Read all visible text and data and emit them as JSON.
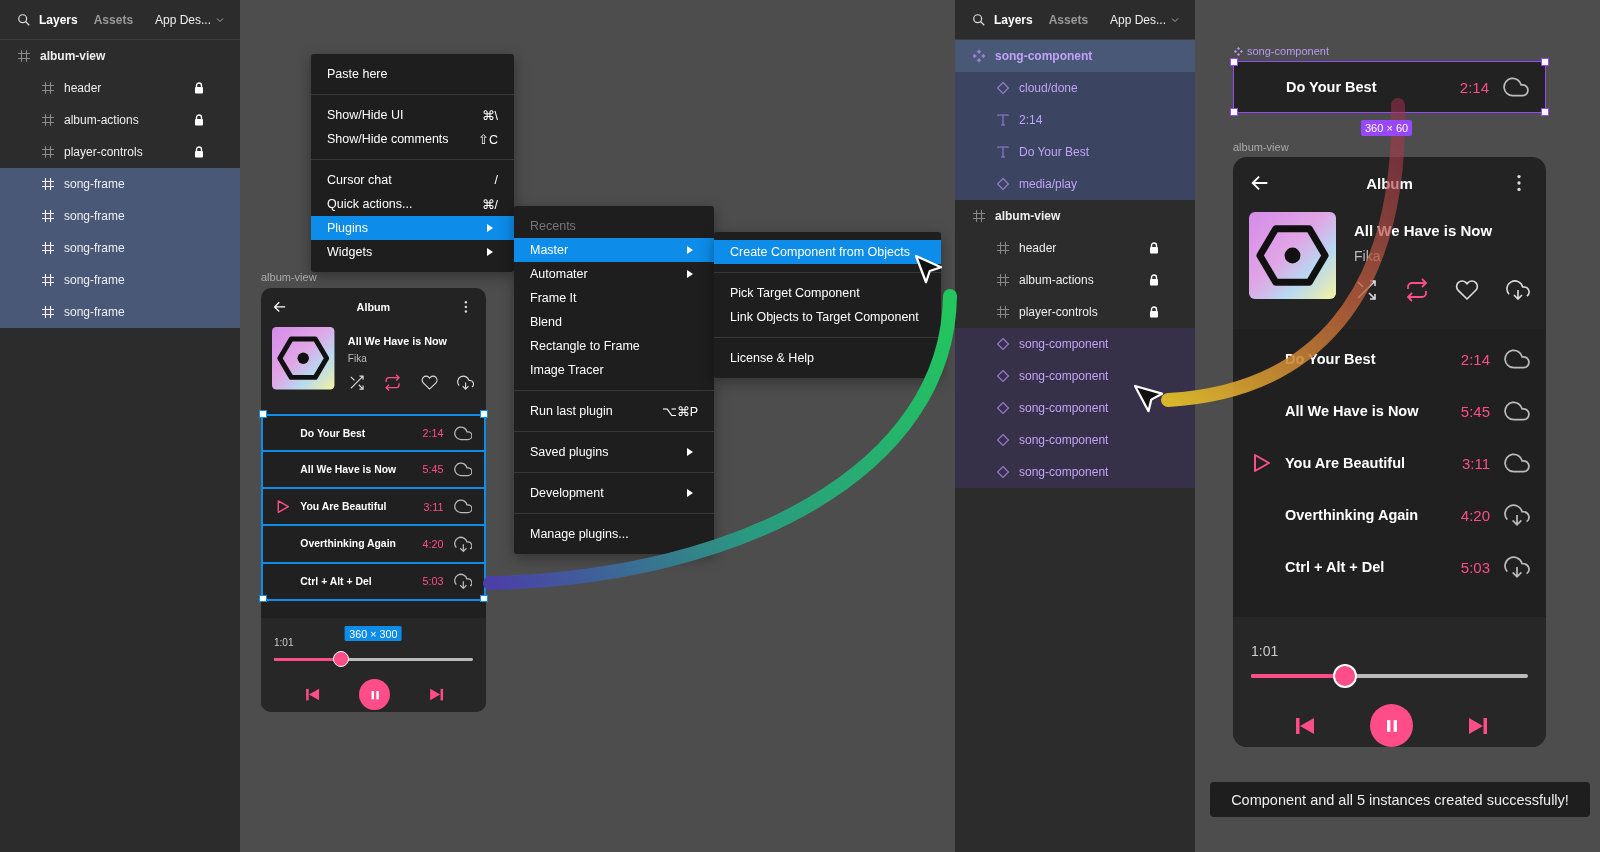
{
  "left_panel": {
    "tabs": [
      {
        "label": "Layers",
        "selected": true
      },
      {
        "label": "Assets",
        "selected": false
      }
    ],
    "file_menu": "App Des...",
    "layers": [
      {
        "name": "album-view",
        "kind": "frame",
        "locked": false,
        "selected": false,
        "children": [
          {
            "name": "header",
            "kind": "frame",
            "locked": true,
            "selected": false
          },
          {
            "name": "album-actions",
            "kind": "frame",
            "locked": true,
            "selected": false
          },
          {
            "name": "player-controls",
            "kind": "frame",
            "locked": true,
            "selected": false
          },
          {
            "name": "song-frame",
            "kind": "frame",
            "locked": false,
            "selected": true
          },
          {
            "name": "song-frame",
            "kind": "frame",
            "locked": false,
            "selected": true
          },
          {
            "name": "song-frame",
            "kind": "frame",
            "locked": false,
            "selected": true
          },
          {
            "name": "song-frame",
            "kind": "frame",
            "locked": false,
            "selected": true
          },
          {
            "name": "song-frame",
            "kind": "frame",
            "locked": false,
            "selected": true
          }
        ]
      }
    ]
  },
  "context_menu": {
    "groups": [
      [
        {
          "label": "Paste here",
          "has_submenu": false,
          "selected": false
        }
      ],
      [
        {
          "label": "Show/Hide UI",
          "shortcut": "⌘\\",
          "has_submenu": false,
          "selected": false
        },
        {
          "label": "Show/Hide comments",
          "shortcut": "⇧C",
          "has_submenu": false,
          "selected": false
        }
      ],
      [
        {
          "label": "Cursor chat",
          "shortcut": "/",
          "has_submenu": false,
          "selected": false
        },
        {
          "label": "Quick actions...",
          "shortcut": "⌘/",
          "has_submenu": false,
          "selected": false
        },
        {
          "label": "Plugins",
          "has_submenu": true,
          "selected": true
        },
        {
          "label": "Widgets",
          "has_submenu": true,
          "selected": false
        }
      ]
    ]
  },
  "plugins_menu": {
    "heading": "Recents",
    "groups": [
      [
        {
          "label": "Master",
          "has_submenu": true,
          "selected": true
        },
        {
          "label": "Automater",
          "has_submenu": true,
          "selected": false
        },
        {
          "label": "Frame It",
          "has_submenu": false,
          "selected": false
        },
        {
          "label": "Blend",
          "has_submenu": false,
          "selected": false
        },
        {
          "label": "Rectangle to Frame",
          "has_submenu": false,
          "selected": false
        },
        {
          "label": "Image Tracer",
          "has_submenu": false,
          "selected": false
        }
      ],
      [
        {
          "label": "Run last plugin",
          "shortcut": "⌥⌘P",
          "has_submenu": false,
          "selected": false
        }
      ],
      [
        {
          "label": "Saved plugins",
          "has_submenu": true,
          "selected": false
        }
      ],
      [
        {
          "label": "Development",
          "has_submenu": true,
          "selected": false
        }
      ],
      [
        {
          "label": "Manage plugins...",
          "has_submenu": false,
          "selected": false
        }
      ]
    ]
  },
  "master_menu": {
    "groups": [
      [
        {
          "label": "Create Component from Objects",
          "has_submenu": false,
          "selected": true
        }
      ],
      [
        {
          "label": "Pick Target Component",
          "has_submenu": false,
          "selected": false
        },
        {
          "label": "Link Objects to Target Component",
          "has_submenu": false,
          "selected": false
        }
      ],
      [
        {
          "label": "License & Help",
          "has_submenu": false,
          "selected": false
        }
      ]
    ]
  },
  "left_canvas": {
    "frame_label": "album-view",
    "selection_size": "360 × 300",
    "album_view": {
      "title": "Album",
      "album_title": "All We Have is Now",
      "artist": "Fika",
      "actions": [
        {
          "kind": "shuffle",
          "on": false
        },
        {
          "kind": "repeat",
          "on": true
        },
        {
          "kind": "heart",
          "on": false
        },
        {
          "kind": "download",
          "on": false
        }
      ],
      "tracks": [
        {
          "title": "Do Your Best",
          "duration": "2:14",
          "kind": "cloud",
          "playing": false,
          "selected": true
        },
        {
          "title": "All We Have is Now",
          "duration": "5:45",
          "kind": "cloud",
          "playing": false,
          "selected": true
        },
        {
          "title": "You Are Beautiful",
          "duration": "3:11",
          "kind": "cloud",
          "playing": true,
          "selected": true
        },
        {
          "title": "Overthinking Again",
          "duration": "4:20",
          "kind": "download",
          "playing": false,
          "selected": true
        },
        {
          "title": "Ctrl + Alt + Del",
          "duration": "5:03",
          "kind": "download",
          "playing": false,
          "selected": true
        }
      ],
      "elapsed": "1:01",
      "level": 0.34,
      "playing": true
    }
  },
  "right_panel": {
    "tabs": [
      {
        "label": "Layers",
        "selected": true
      },
      {
        "label": "Assets",
        "selected": false
      }
    ],
    "file_menu": "App Des...",
    "layers": [
      {
        "name": "song-component",
        "kind": "component",
        "locked": false,
        "selected": true,
        "children": [
          {
            "name": "cloud/done",
            "kind": "instance",
            "locked": false,
            "selected": false
          },
          {
            "name": "2:14",
            "kind": "text",
            "locked": false,
            "selected": false
          },
          {
            "name": "Do Your Best",
            "kind": "text",
            "locked": false,
            "selected": false
          },
          {
            "name": "media/play",
            "kind": "instance",
            "locked": false,
            "selected": false
          }
        ]
      },
      {
        "name": "album-view",
        "kind": "frame",
        "locked": false,
        "selected": false,
        "children": [
          {
            "name": "header",
            "kind": "frame",
            "locked": true,
            "selected": false
          },
          {
            "name": "album-actions",
            "kind": "frame",
            "locked": true,
            "selected": false
          },
          {
            "name": "player-controls",
            "kind": "frame",
            "locked": true,
            "selected": false
          },
          {
            "name": "song-component",
            "kind": "instance",
            "locked": false,
            "selected": true
          },
          {
            "name": "song-component",
            "kind": "instance",
            "locked": false,
            "selected": true
          },
          {
            "name": "song-component",
            "kind": "instance",
            "locked": false,
            "selected": true
          },
          {
            "name": "song-component",
            "kind": "instance",
            "locked": false,
            "selected": true
          },
          {
            "name": "song-component",
            "kind": "instance",
            "locked": false,
            "selected": true
          }
        ]
      }
    ]
  },
  "right_canvas": {
    "component_label": "song-component",
    "component": {
      "title": "Do Your Best",
      "duration": "2:14",
      "kind": "cloud"
    },
    "component_size": "360 × 60",
    "frame_label": "album-view",
    "album_view": {
      "title": "Album",
      "album_title": "All We Have is Now",
      "artist": "Fika",
      "actions": [
        {
          "kind": "shuffle",
          "on": false
        },
        {
          "kind": "repeat",
          "on": true
        },
        {
          "kind": "heart",
          "on": false
        },
        {
          "kind": "download",
          "on": false
        }
      ],
      "tracks": [
        {
          "title": "Do Your Best",
          "duration": "2:14",
          "kind": "cloud",
          "playing": false,
          "selected": false
        },
        {
          "title": "All We Have is Now",
          "duration": "5:45",
          "kind": "cloud",
          "playing": false,
          "selected": false
        },
        {
          "title": "You Are Beautiful",
          "duration": "3:11",
          "kind": "cloud",
          "playing": true,
          "selected": false
        },
        {
          "title": "Overthinking Again",
          "duration": "4:20",
          "kind": "download",
          "playing": false,
          "selected": false
        },
        {
          "title": "Ctrl + Alt + Del",
          "duration": "5:03",
          "kind": "download",
          "playing": false,
          "selected": false
        }
      ],
      "elapsed": "1:01",
      "level": 0.34,
      "playing": true
    }
  },
  "toast": "Component and all 5 instances created successfully!"
}
